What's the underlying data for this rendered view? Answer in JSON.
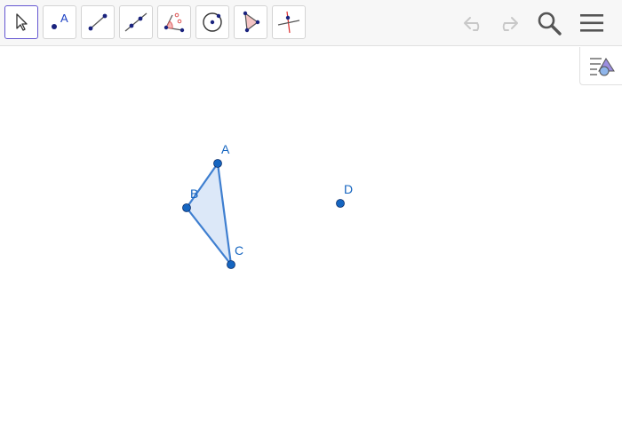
{
  "toolbar": {
    "tools": [
      {
        "name": "move-tool",
        "icon": "cursor-arrow-icon",
        "active": true
      },
      {
        "name": "point-tool",
        "icon": "point-icon",
        "label": "A"
      },
      {
        "name": "segment-tool",
        "icon": "segment-icon"
      },
      {
        "name": "line-tool",
        "icon": "line-icon"
      },
      {
        "name": "angle-tool",
        "icon": "angle-icon"
      },
      {
        "name": "circle-tool",
        "icon": "circle-icon"
      },
      {
        "name": "polygon-tool",
        "icon": "polygon-icon"
      },
      {
        "name": "perpendicular-line-tool",
        "icon": "perpendicular-line-icon"
      }
    ],
    "controls": [
      "undo-icon",
      "redo-icon",
      "search-icon",
      "menu-icon"
    ]
  },
  "side_panel": {
    "icon": "algebra-view-toggle-icon"
  },
  "graphics": {
    "points": [
      {
        "label": "A"
      },
      {
        "label": "B"
      },
      {
        "label": "C"
      },
      {
        "label": "D"
      }
    ],
    "polygon": {
      "vertices": [
        "A",
        "B",
        "C"
      ]
    },
    "colors": {
      "point_fill": "#1565c0",
      "polygon_fill": "#dce8f8",
      "polygon_stroke": "#3f7fd0",
      "label": "#1565c0"
    }
  }
}
